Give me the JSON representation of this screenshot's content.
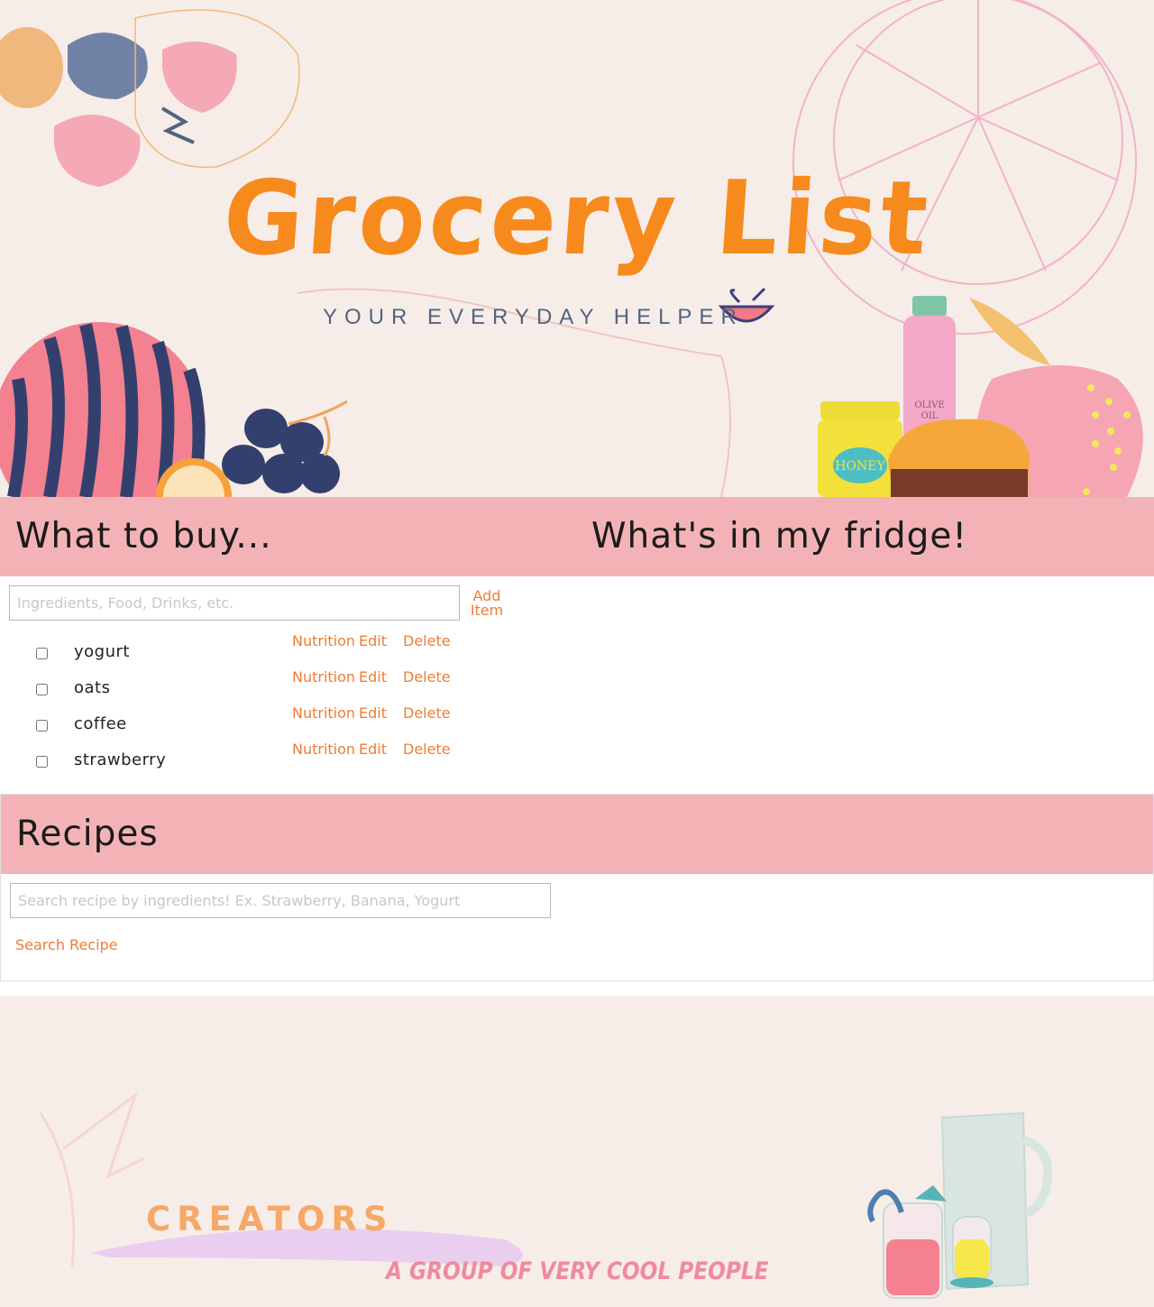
{
  "hero": {
    "title": "Grocery List",
    "tagline": "YOUR EVERYDAY HELPER",
    "label_honey": "HONEY",
    "label_olive_oil_1": "OLIVE",
    "label_olive_oil_2": "OIL",
    "colors": {
      "title": "#f78a1d",
      "tagline": "#54637e",
      "background": "#f6ede9"
    }
  },
  "shopping": {
    "heading": "What to buy...",
    "input_placeholder": "Ingredients, Food, Drinks, etc.",
    "add_button": "Add Item",
    "items": [
      {
        "name": "yogurt",
        "checked": false
      },
      {
        "name": "oats",
        "checked": false
      },
      {
        "name": "coffee",
        "checked": false
      },
      {
        "name": "strawberry",
        "checked": false
      }
    ],
    "nutrition_label": "Nutrition",
    "edit_label": "Edit",
    "delete_label": "Delete"
  },
  "fridge": {
    "heading": "What's in my fridge!"
  },
  "recipes": {
    "heading": "Recipes",
    "search_placeholder": "Search recipe by ingredients! Ex. Strawberry, Banana, Yogurt",
    "search_button": "Search Recipe"
  },
  "footer": {
    "title": "CREATORS",
    "subtitle": "A GROUP OF VERY COOL PEOPLE"
  },
  "theme": {
    "section_bar": "#f3b3b6",
    "link": "#ee7d35"
  }
}
